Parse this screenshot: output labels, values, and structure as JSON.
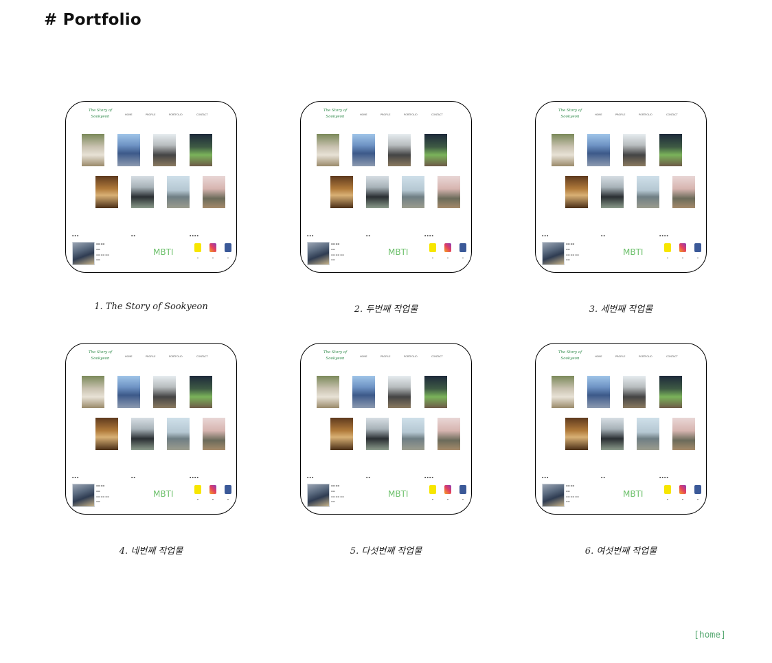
{
  "page": {
    "title": "# Portfolio"
  },
  "preview": {
    "logo": "The Story of Sookyeon",
    "nav": [
      "HOME",
      "PROFILE",
      "PORTFOLIO",
      "CONTACT"
    ],
    "mbti": "MBTI"
  },
  "cards": [
    {
      "caption": "1. The Story of Sookyeon"
    },
    {
      "caption": "2. 두번째 작업물"
    },
    {
      "caption": "3. 세번째 작업물"
    },
    {
      "caption": "4. 네번째 작업물"
    },
    {
      "caption": "5. 다섯번째 작업물"
    },
    {
      "caption": "6. 여섯번째 작업물"
    }
  ],
  "footer": {
    "home_label": "[home]"
  }
}
